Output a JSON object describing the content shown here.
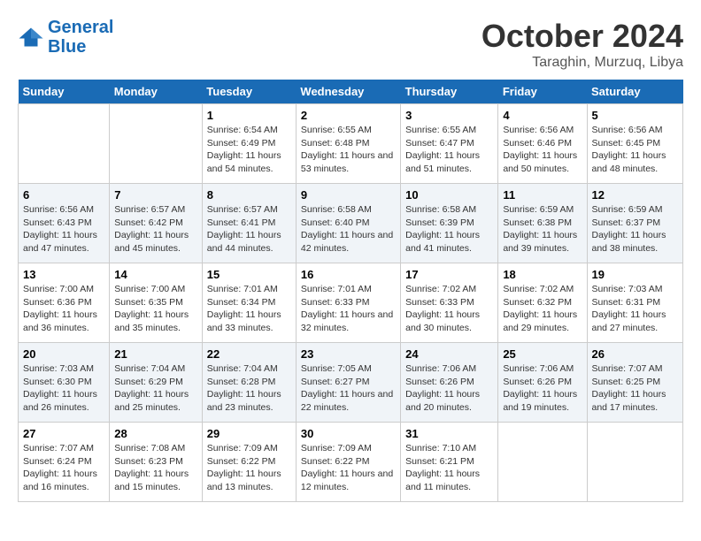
{
  "logo": {
    "general": "General",
    "blue": "Blue"
  },
  "title": "October 2024",
  "subtitle": "Taraghin, Murzuq, Libya",
  "days_of_week": [
    "Sunday",
    "Monday",
    "Tuesday",
    "Wednesday",
    "Thursday",
    "Friday",
    "Saturday"
  ],
  "weeks": [
    [
      {
        "day": "",
        "sunrise": "",
        "sunset": "",
        "daylight": ""
      },
      {
        "day": "",
        "sunrise": "",
        "sunset": "",
        "daylight": ""
      },
      {
        "day": "1",
        "sunrise": "Sunrise: 6:54 AM",
        "sunset": "Sunset: 6:49 PM",
        "daylight": "Daylight: 11 hours and 54 minutes."
      },
      {
        "day": "2",
        "sunrise": "Sunrise: 6:55 AM",
        "sunset": "Sunset: 6:48 PM",
        "daylight": "Daylight: 11 hours and 53 minutes."
      },
      {
        "day": "3",
        "sunrise": "Sunrise: 6:55 AM",
        "sunset": "Sunset: 6:47 PM",
        "daylight": "Daylight: 11 hours and 51 minutes."
      },
      {
        "day": "4",
        "sunrise": "Sunrise: 6:56 AM",
        "sunset": "Sunset: 6:46 PM",
        "daylight": "Daylight: 11 hours and 50 minutes."
      },
      {
        "day": "5",
        "sunrise": "Sunrise: 6:56 AM",
        "sunset": "Sunset: 6:45 PM",
        "daylight": "Daylight: 11 hours and 48 minutes."
      }
    ],
    [
      {
        "day": "6",
        "sunrise": "Sunrise: 6:56 AM",
        "sunset": "Sunset: 6:43 PM",
        "daylight": "Daylight: 11 hours and 47 minutes."
      },
      {
        "day": "7",
        "sunrise": "Sunrise: 6:57 AM",
        "sunset": "Sunset: 6:42 PM",
        "daylight": "Daylight: 11 hours and 45 minutes."
      },
      {
        "day": "8",
        "sunrise": "Sunrise: 6:57 AM",
        "sunset": "Sunset: 6:41 PM",
        "daylight": "Daylight: 11 hours and 44 minutes."
      },
      {
        "day": "9",
        "sunrise": "Sunrise: 6:58 AM",
        "sunset": "Sunset: 6:40 PM",
        "daylight": "Daylight: 11 hours and 42 minutes."
      },
      {
        "day": "10",
        "sunrise": "Sunrise: 6:58 AM",
        "sunset": "Sunset: 6:39 PM",
        "daylight": "Daylight: 11 hours and 41 minutes."
      },
      {
        "day": "11",
        "sunrise": "Sunrise: 6:59 AM",
        "sunset": "Sunset: 6:38 PM",
        "daylight": "Daylight: 11 hours and 39 minutes."
      },
      {
        "day": "12",
        "sunrise": "Sunrise: 6:59 AM",
        "sunset": "Sunset: 6:37 PM",
        "daylight": "Daylight: 11 hours and 38 minutes."
      }
    ],
    [
      {
        "day": "13",
        "sunrise": "Sunrise: 7:00 AM",
        "sunset": "Sunset: 6:36 PM",
        "daylight": "Daylight: 11 hours and 36 minutes."
      },
      {
        "day": "14",
        "sunrise": "Sunrise: 7:00 AM",
        "sunset": "Sunset: 6:35 PM",
        "daylight": "Daylight: 11 hours and 35 minutes."
      },
      {
        "day": "15",
        "sunrise": "Sunrise: 7:01 AM",
        "sunset": "Sunset: 6:34 PM",
        "daylight": "Daylight: 11 hours and 33 minutes."
      },
      {
        "day": "16",
        "sunrise": "Sunrise: 7:01 AM",
        "sunset": "Sunset: 6:33 PM",
        "daylight": "Daylight: 11 hours and 32 minutes."
      },
      {
        "day": "17",
        "sunrise": "Sunrise: 7:02 AM",
        "sunset": "Sunset: 6:33 PM",
        "daylight": "Daylight: 11 hours and 30 minutes."
      },
      {
        "day": "18",
        "sunrise": "Sunrise: 7:02 AM",
        "sunset": "Sunset: 6:32 PM",
        "daylight": "Daylight: 11 hours and 29 minutes."
      },
      {
        "day": "19",
        "sunrise": "Sunrise: 7:03 AM",
        "sunset": "Sunset: 6:31 PM",
        "daylight": "Daylight: 11 hours and 27 minutes."
      }
    ],
    [
      {
        "day": "20",
        "sunrise": "Sunrise: 7:03 AM",
        "sunset": "Sunset: 6:30 PM",
        "daylight": "Daylight: 11 hours and 26 minutes."
      },
      {
        "day": "21",
        "sunrise": "Sunrise: 7:04 AM",
        "sunset": "Sunset: 6:29 PM",
        "daylight": "Daylight: 11 hours and 25 minutes."
      },
      {
        "day": "22",
        "sunrise": "Sunrise: 7:04 AM",
        "sunset": "Sunset: 6:28 PM",
        "daylight": "Daylight: 11 hours and 23 minutes."
      },
      {
        "day": "23",
        "sunrise": "Sunrise: 7:05 AM",
        "sunset": "Sunset: 6:27 PM",
        "daylight": "Daylight: 11 hours and 22 minutes."
      },
      {
        "day": "24",
        "sunrise": "Sunrise: 7:06 AM",
        "sunset": "Sunset: 6:26 PM",
        "daylight": "Daylight: 11 hours and 20 minutes."
      },
      {
        "day": "25",
        "sunrise": "Sunrise: 7:06 AM",
        "sunset": "Sunset: 6:26 PM",
        "daylight": "Daylight: 11 hours and 19 minutes."
      },
      {
        "day": "26",
        "sunrise": "Sunrise: 7:07 AM",
        "sunset": "Sunset: 6:25 PM",
        "daylight": "Daylight: 11 hours and 17 minutes."
      }
    ],
    [
      {
        "day": "27",
        "sunrise": "Sunrise: 7:07 AM",
        "sunset": "Sunset: 6:24 PM",
        "daylight": "Daylight: 11 hours and 16 minutes."
      },
      {
        "day": "28",
        "sunrise": "Sunrise: 7:08 AM",
        "sunset": "Sunset: 6:23 PM",
        "daylight": "Daylight: 11 hours and 15 minutes."
      },
      {
        "day": "29",
        "sunrise": "Sunrise: 7:09 AM",
        "sunset": "Sunset: 6:22 PM",
        "daylight": "Daylight: 11 hours and 13 minutes."
      },
      {
        "day": "30",
        "sunrise": "Sunrise: 7:09 AM",
        "sunset": "Sunset: 6:22 PM",
        "daylight": "Daylight: 11 hours and 12 minutes."
      },
      {
        "day": "31",
        "sunrise": "Sunrise: 7:10 AM",
        "sunset": "Sunset: 6:21 PM",
        "daylight": "Daylight: 11 hours and 11 minutes."
      },
      {
        "day": "",
        "sunrise": "",
        "sunset": "",
        "daylight": ""
      },
      {
        "day": "",
        "sunrise": "",
        "sunset": "",
        "daylight": ""
      }
    ]
  ]
}
